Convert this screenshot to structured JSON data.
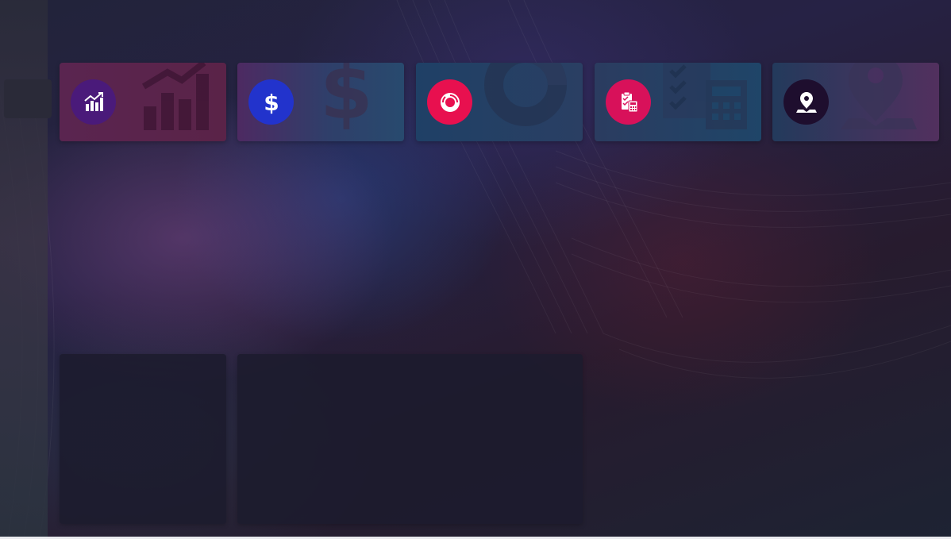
{
  "colors": {
    "analytics_accent": "#4a1a7a",
    "revenue_accent": "#2233cc",
    "sessions_accent": "#e8104f",
    "orders_accent": "#d8115a",
    "locations_accent": "#1e0e2e"
  },
  "stat_cards": [
    {
      "icon": "bar-chart-trend-icon",
      "accent": "#4a1a7a"
    },
    {
      "icon": "dollar-icon",
      "accent": "#2233cc"
    },
    {
      "icon": "donut-chart-icon",
      "accent": "#e8104f"
    },
    {
      "icon": "clipboard-calculator-icon",
      "accent": "#d8115a"
    },
    {
      "icon": "map-pin-icon",
      "accent": "#1e0e2e"
    }
  ],
  "panels": [
    {
      "name": "left-panel"
    },
    {
      "name": "right-panel"
    }
  ]
}
